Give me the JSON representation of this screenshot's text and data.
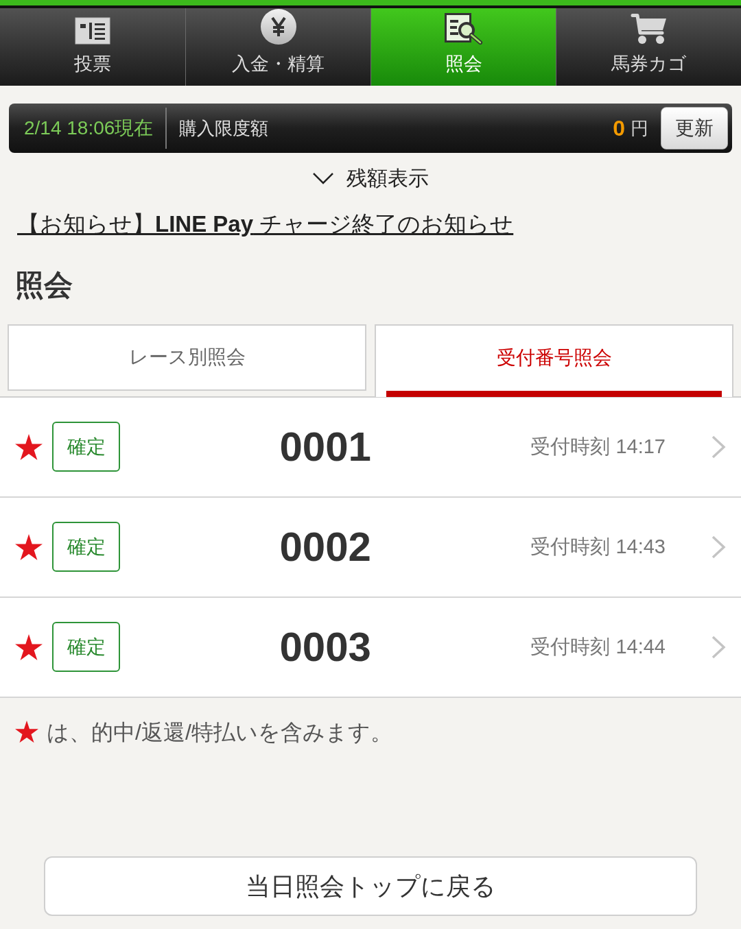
{
  "nav": [
    {
      "label": "投票",
      "kind": "ballot",
      "selected": false
    },
    {
      "label": "入金・精算",
      "kind": "coin",
      "selected": false
    },
    {
      "label": "照会",
      "kind": "inquiry",
      "selected": true
    },
    {
      "label": "馬券カゴ",
      "kind": "cart",
      "selected": false
    }
  ],
  "balance_bar": {
    "as_of": "2/14 18:06現在",
    "label": "購入限度額",
    "amount": "0",
    "unit": "円",
    "refresh_button": "更新"
  },
  "balance_toggle": {
    "label": "残額表示",
    "expanded": false
  },
  "notice_link": "【お知らせ】**LINE Pay** チャージ終了のお知らせ",
  "heading": "照会",
  "tabs": [
    {
      "label": "レース別照会",
      "selected": false
    },
    {
      "label": "受付番号照会",
      "selected": true
    }
  ],
  "receipts": [
    {
      "starred": true,
      "status": "確定",
      "number": "0001",
      "time": "受付時刻 14:17"
    },
    {
      "starred": true,
      "status": "確定",
      "number": "0002",
      "time": "受付時刻 14:43"
    },
    {
      "starred": true,
      "status": "確定",
      "number": "0003",
      "time": "受付時刻 14:44"
    }
  ],
  "legend": "は、的中/返還/特払いを含みます。",
  "back_button": "当日照会トップに戻る"
}
